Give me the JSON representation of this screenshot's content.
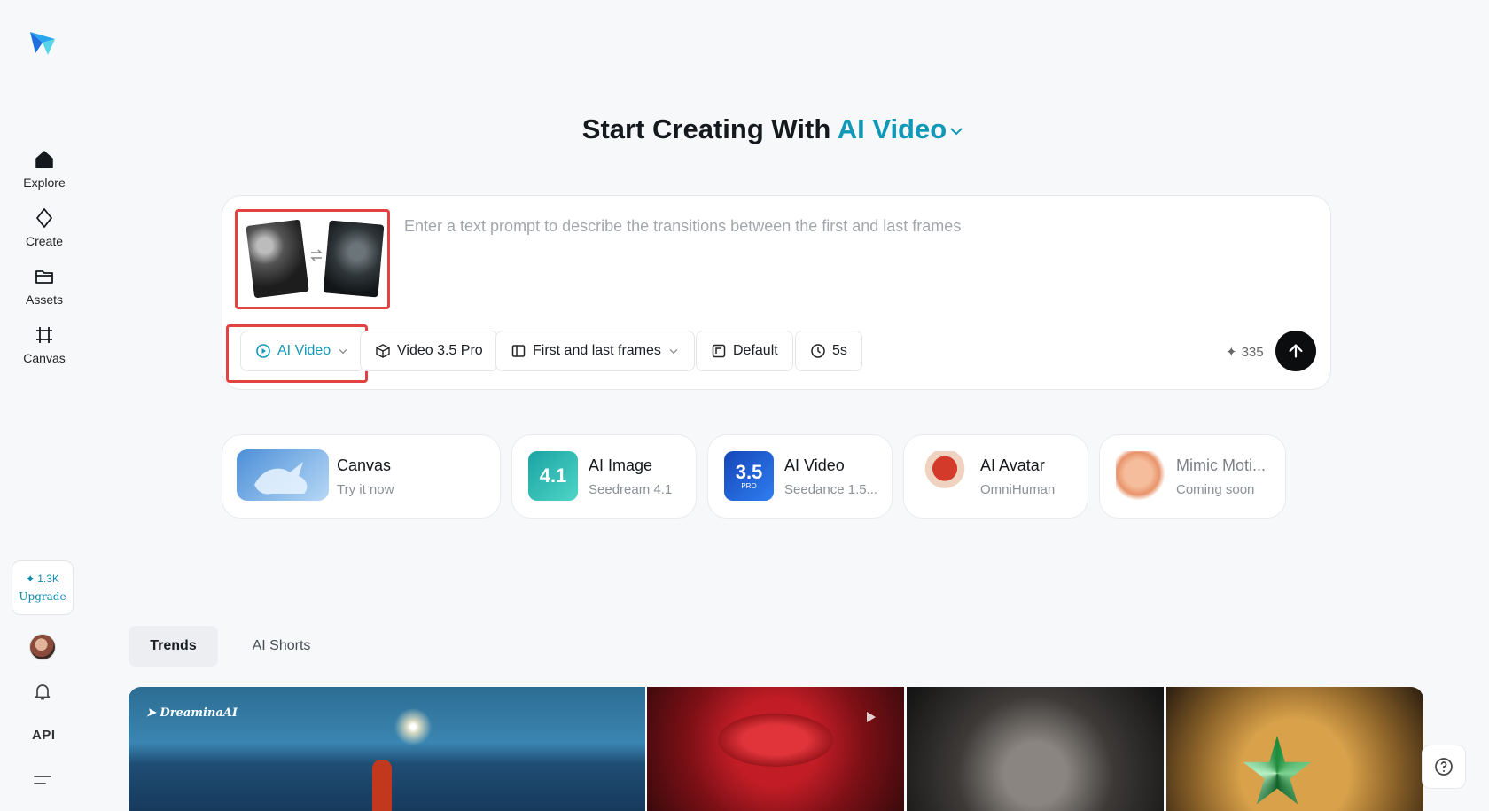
{
  "sidebar": {
    "items": [
      {
        "label": "Explore"
      },
      {
        "label": "Create"
      },
      {
        "label": "Assets"
      },
      {
        "label": "Canvas"
      }
    ],
    "credits": "1.3K",
    "upgrade_label": "Upgrade",
    "api_label": "API"
  },
  "header": {
    "title_prefix": "Start Creating With",
    "title_accent": "AI Video"
  },
  "prompt": {
    "placeholder": "Enter a text prompt to describe the transitions between the first and last frames",
    "value": ""
  },
  "controls": {
    "mode": "AI Video",
    "model": "Video 3.5 Pro",
    "frames": "First and last frames",
    "ratio": "Default",
    "duration": "5s",
    "credit_cost": "335"
  },
  "tools": [
    {
      "name": "Canvas",
      "sub": "Try it now"
    },
    {
      "name": "AI Image",
      "sub": "Seedream 4.1",
      "badge": "4.1"
    },
    {
      "name": "AI Video",
      "sub": "Seedance 1.5...",
      "badge": "3.5",
      "badge_sub": "PRO"
    },
    {
      "name": "AI Avatar",
      "sub": "OmniHuman"
    },
    {
      "name": "Mimic Moti...",
      "sub": "Coming soon"
    }
  ],
  "tabs": [
    {
      "label": "Trends"
    },
    {
      "label": "AI Shorts"
    }
  ],
  "gallery": {
    "watermark": "DreaminaAI"
  },
  "colors": {
    "accent": "#0f98b8",
    "highlight": "#e34242",
    "send": "#0c0d0f"
  }
}
